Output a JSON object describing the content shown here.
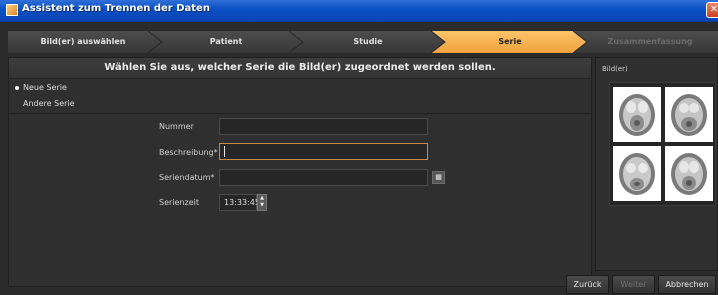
{
  "window": {
    "title": "Assistent zum Trennen der Daten"
  },
  "steps": [
    {
      "label": "Bild(er) auswählen",
      "state": "done"
    },
    {
      "label": "Patient",
      "state": "done"
    },
    {
      "label": "Studie",
      "state": "done"
    },
    {
      "label": "Serie",
      "state": "active"
    },
    {
      "label": "Zusammenfassung",
      "state": "pending"
    }
  ],
  "main": {
    "heading": "Wählen Sie aus, welcher Serie die Bild(er) zugeordnet werden sollen.",
    "options": [
      {
        "label": "Neue Serie",
        "selected": true
      },
      {
        "label": "Andere Serie",
        "selected": false
      }
    ],
    "form": {
      "nummer_label": "Nummer",
      "nummer_value": "",
      "beschreibung_label": "Beschreibung*",
      "beschreibung_value": "",
      "seriendatum_label": "Seriendatum*",
      "seriendatum_value": "",
      "serienzeit_label": "Serienzeit",
      "serienzeit_value": "13:33:45"
    }
  },
  "preview": {
    "label": "Bild(er)"
  },
  "buttons": {
    "back": "Zurück",
    "next": "Weiter",
    "cancel": "Abbrechen"
  },
  "colors": {
    "active_step": "#f7b04a",
    "titlebar": "#0a4fc4",
    "focus_border": "#c98a45"
  }
}
